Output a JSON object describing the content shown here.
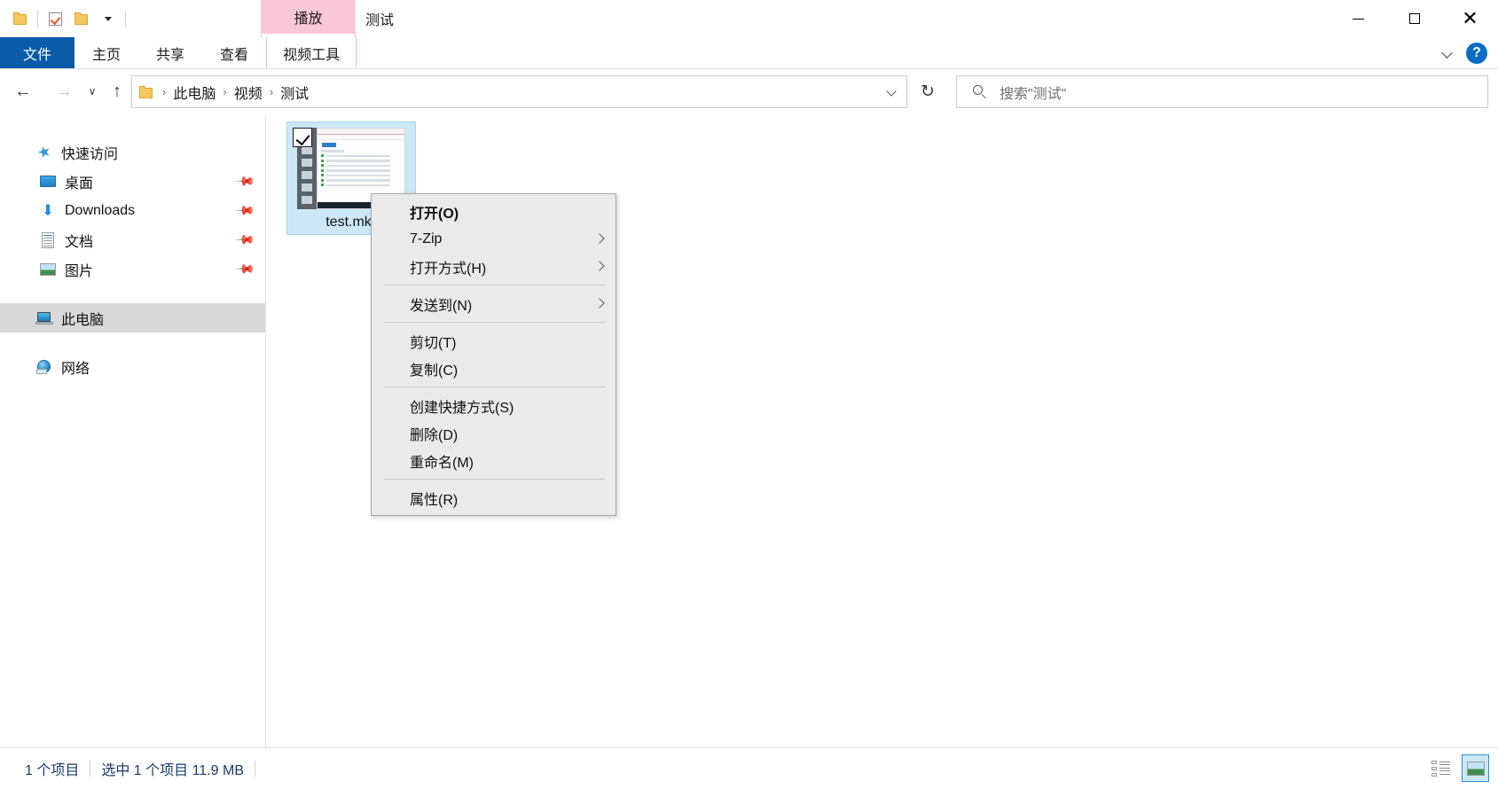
{
  "window": {
    "title": "测试",
    "controls": {
      "minimize": "—",
      "maximize": "□",
      "close": "✕"
    }
  },
  "quick_access_toolbar": {
    "items": [
      {
        "name": "properties-folder-icon",
        "icon": "folder-icon"
      },
      {
        "name": "new-folder-check-icon",
        "icon": "checkbox-icon"
      },
      {
        "name": "new-folder-icon",
        "icon": "folder-icon"
      }
    ]
  },
  "contextual_tab": {
    "group_label": "播放",
    "group_sub_label": "视频工具"
  },
  "ribbon": {
    "tabs": [
      {
        "label": "文件",
        "active": true
      },
      {
        "label": "主页",
        "active": false
      },
      {
        "label": "共享",
        "active": false
      },
      {
        "label": "查看",
        "active": false
      },
      {
        "label": "视频工具",
        "active": false
      }
    ],
    "collapse_label": "∨",
    "help_label": "?"
  },
  "navigation": {
    "back": "←",
    "forward": "→",
    "history": "∨",
    "up": "↑",
    "refresh": "↻"
  },
  "address_bar": {
    "crumbs": [
      "此电脑",
      "视频",
      "测试"
    ],
    "separator": "›",
    "dropdown": "∨"
  },
  "search": {
    "placeholder": "搜索\"测试\"",
    "icon": "search-icon"
  },
  "sidebar": {
    "items": [
      {
        "label": "快速访问",
        "icon": "star-icon",
        "pinned": false,
        "selected": false,
        "indent": 0
      },
      {
        "label": "桌面",
        "icon": "desktop-icon",
        "pinned": true,
        "selected": false,
        "indent": 1
      },
      {
        "label": "Downloads",
        "icon": "download-icon",
        "pinned": true,
        "selected": false,
        "indent": 1
      },
      {
        "label": "文档",
        "icon": "document-icon",
        "pinned": true,
        "selected": false,
        "indent": 1
      },
      {
        "label": "图片",
        "icon": "picture-icon",
        "pinned": true,
        "selected": false,
        "indent": 1
      },
      {
        "label": "此电脑",
        "icon": "computer-icon",
        "pinned": false,
        "selected": true,
        "indent": 0
      },
      {
        "label": "网络",
        "icon": "network-icon",
        "pinned": false,
        "selected": false,
        "indent": 0
      }
    ],
    "pin_glyph": "📌"
  },
  "files": [
    {
      "name": "test.mkv",
      "selected": true,
      "checked": true,
      "icon": "video-thumbnail"
    }
  ],
  "context_menu": {
    "items": [
      {
        "label": "打开(O)",
        "bold": true,
        "submenu": false,
        "sep_after": false
      },
      {
        "label": "7-Zip",
        "bold": false,
        "submenu": true,
        "sep_after": false
      },
      {
        "label": "打开方式(H)",
        "bold": false,
        "submenu": true,
        "sep_after": true
      },
      {
        "label": "发送到(N)",
        "bold": false,
        "submenu": true,
        "sep_after": true
      },
      {
        "label": "剪切(T)",
        "bold": false,
        "submenu": false,
        "sep_after": false
      },
      {
        "label": "复制(C)",
        "bold": false,
        "submenu": false,
        "sep_after": true
      },
      {
        "label": "创建快捷方式(S)",
        "bold": false,
        "submenu": false,
        "sep_after": false
      },
      {
        "label": "删除(D)",
        "bold": false,
        "submenu": false,
        "sep_after": false
      },
      {
        "label": "重命名(M)",
        "bold": false,
        "submenu": false,
        "sep_after": true
      },
      {
        "label": "属性(R)",
        "bold": false,
        "submenu": false,
        "sep_after": false
      }
    ]
  },
  "status_bar": {
    "item_count": "1 个项目",
    "selection": "选中 1 个项目  11.9 MB",
    "views": [
      {
        "name": "details-view",
        "active": false
      },
      {
        "name": "large-icons-view",
        "active": true
      }
    ]
  },
  "colors": {
    "accent": "#0a5ba8",
    "contextual_tab": "#f9c8d8",
    "selection": "#cce8f7",
    "sidebar_selected": "#d9d9d9",
    "status_text": "#1a3a6b",
    "menu_bg": "#eaeaea"
  }
}
